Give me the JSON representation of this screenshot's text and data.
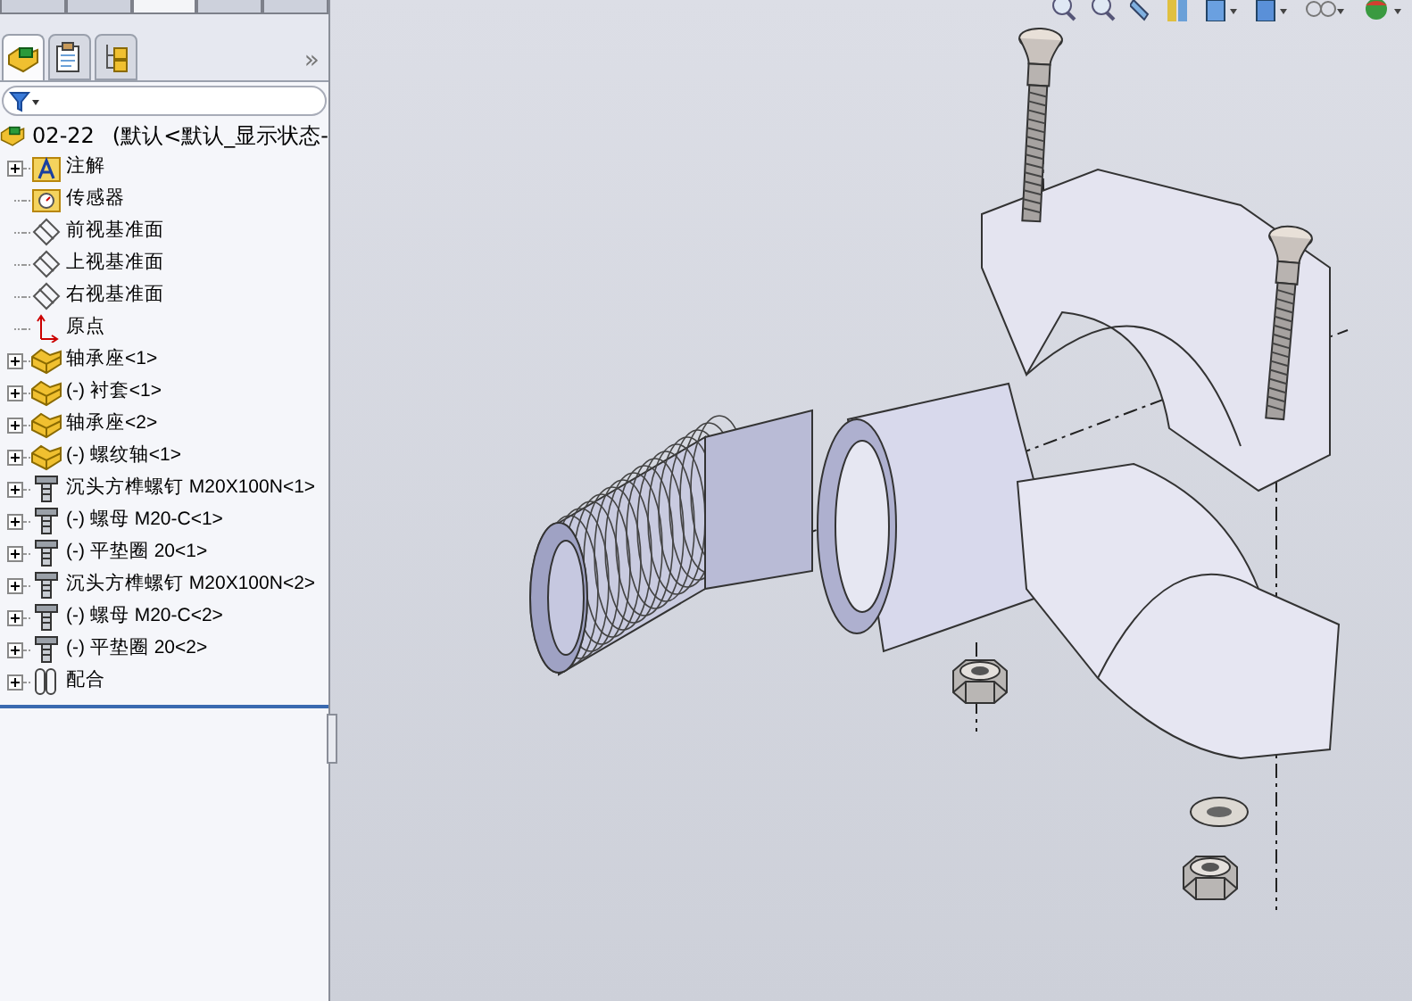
{
  "command_tabs": [
    {
      "selected": false
    },
    {
      "selected": false
    },
    {
      "selected": true
    },
    {
      "selected": false
    },
    {
      "selected": false
    }
  ],
  "panel_tabs": [
    {
      "kind": "feature",
      "selected": true
    },
    {
      "kind": "property",
      "selected": false
    },
    {
      "kind": "config",
      "selected": false
    }
  ],
  "panel_more": "»",
  "tree": {
    "root": {
      "label": "02-22",
      "config": "(默认<默认_显示状态-"
    },
    "items": [
      {
        "kind": "annotation",
        "label": "注解",
        "expandable": true
      },
      {
        "kind": "sensor",
        "label": "传感器",
        "expandable": false
      },
      {
        "kind": "plane",
        "label": "前视基准面",
        "expandable": false
      },
      {
        "kind": "plane",
        "label": "上视基准面",
        "expandable": false
      },
      {
        "kind": "plane",
        "label": "右视基准面",
        "expandable": false
      },
      {
        "kind": "origin",
        "label": "原点",
        "expandable": false
      },
      {
        "kind": "part",
        "label": "轴承座<1>",
        "expandable": true
      },
      {
        "kind": "part",
        "label": "(-) 衬套<1>",
        "expandable": true
      },
      {
        "kind": "part",
        "label": "轴承座<2>",
        "expandable": true
      },
      {
        "kind": "part",
        "label": "(-) 螺纹轴<1>",
        "expandable": true
      },
      {
        "kind": "toolbox",
        "label": "沉头方榫螺钉 M20X100N<1>",
        "expandable": true
      },
      {
        "kind": "toolbox",
        "label": "(-) 螺母 M20-C<1>",
        "expandable": true
      },
      {
        "kind": "toolbox",
        "label": "(-) 平垫圈 20<1>",
        "expandable": true
      },
      {
        "kind": "toolbox",
        "label": "沉头方榫螺钉 M20X100N<2>",
        "expandable": true
      },
      {
        "kind": "toolbox",
        "label": "(-) 螺母 M20-C<2>",
        "expandable": true
      },
      {
        "kind": "toolbox",
        "label": "(-) 平垫圈 20<2>",
        "expandable": true
      },
      {
        "kind": "mates",
        "label": "配合",
        "expandable": true
      }
    ]
  }
}
